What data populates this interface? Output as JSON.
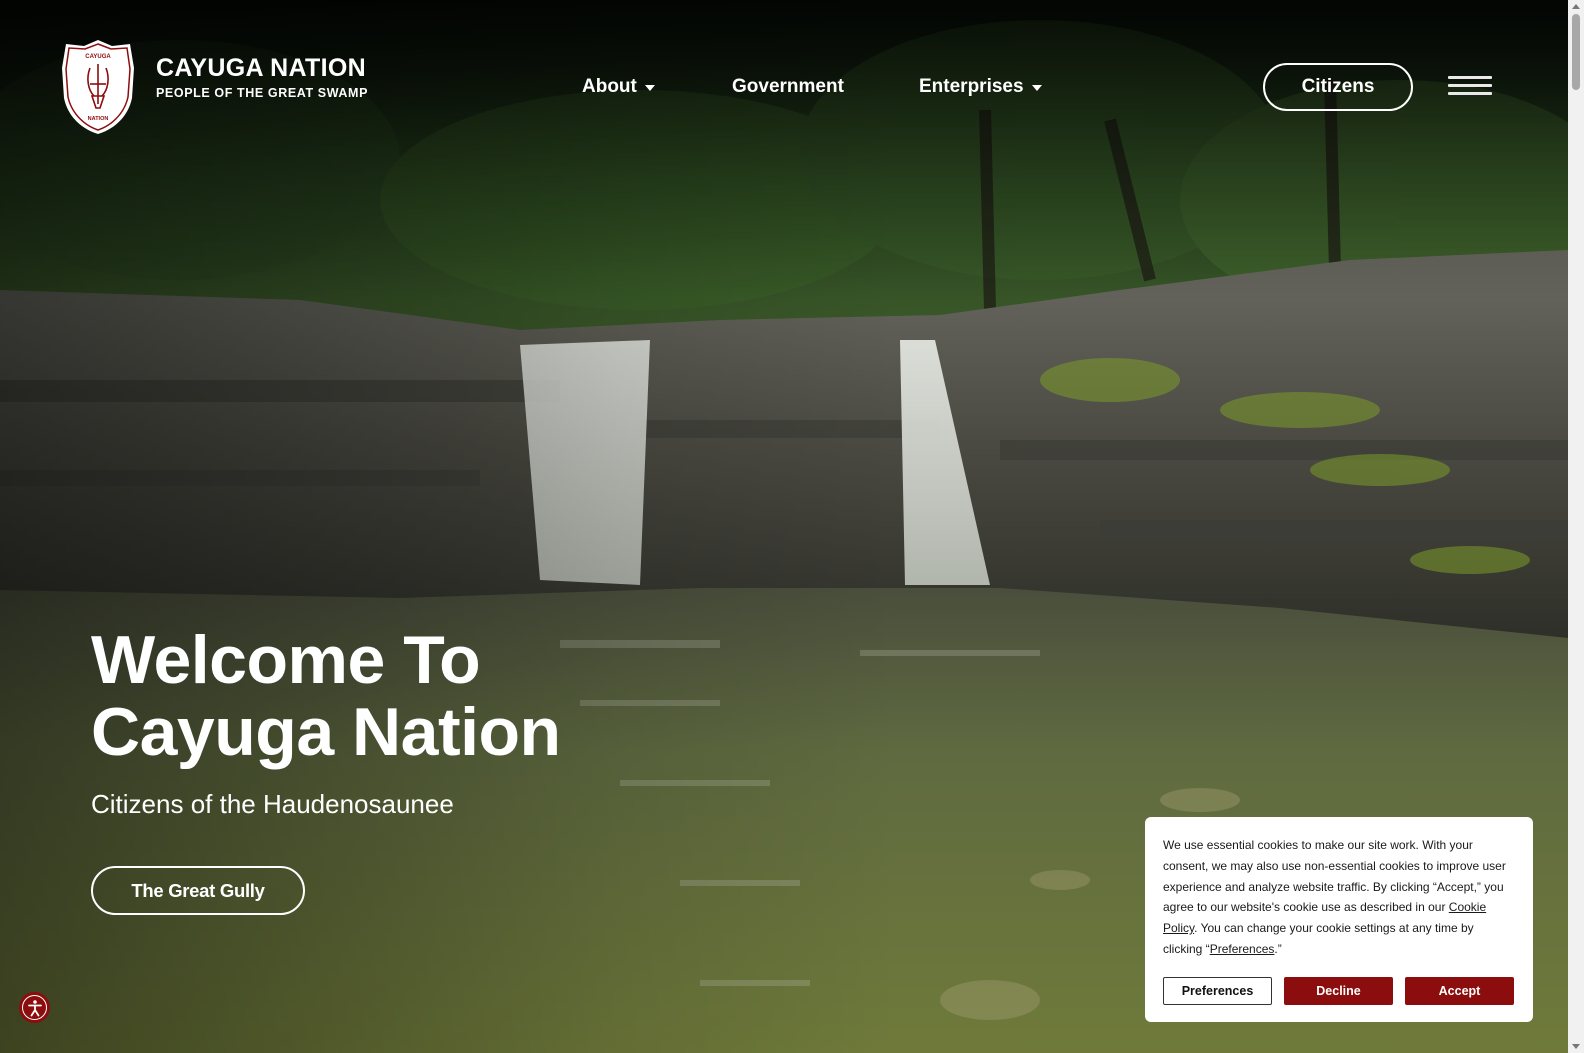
{
  "header": {
    "brand_name": "CAYUGA NATION",
    "brand_tagline": "PEOPLE OF THE GREAT SWAMP",
    "logo_text_top": "CAYUGA",
    "logo_text_bottom": "NATION",
    "nav": [
      {
        "label": "About",
        "has_dropdown": true
      },
      {
        "label": "Government",
        "has_dropdown": false
      },
      {
        "label": "Enterprises",
        "has_dropdown": true
      }
    ],
    "citizens_label": "Citizens",
    "menu_icon": "hamburger-menu-icon"
  },
  "hero": {
    "title_line1": "Welcome To",
    "title_line2": "Cayuga Nation",
    "subtitle": "Citizens of the Haudenosaunee",
    "cta_label": "The Great Gully"
  },
  "cookie_banner": {
    "text_1": "We use essential cookies to make our site work. With your consent, we may also use non-essential cookies to improve user experience and analyze website traffic. By clicking “Accept,” you agree to our website's cookie use as described in our ",
    "cookie_policy_link": "Cookie Policy",
    "text_2": ". You can change your cookie settings at any time by clicking “",
    "preferences_link": "Preferences",
    "text_3": ".”",
    "preferences_button": "Preferences",
    "decline_button": "Decline",
    "accept_button": "Accept"
  },
  "accessibility": {
    "icon": "accessibility-icon"
  },
  "colors": {
    "brand_red": "#8b0d0d",
    "text_white": "#ffffff"
  }
}
